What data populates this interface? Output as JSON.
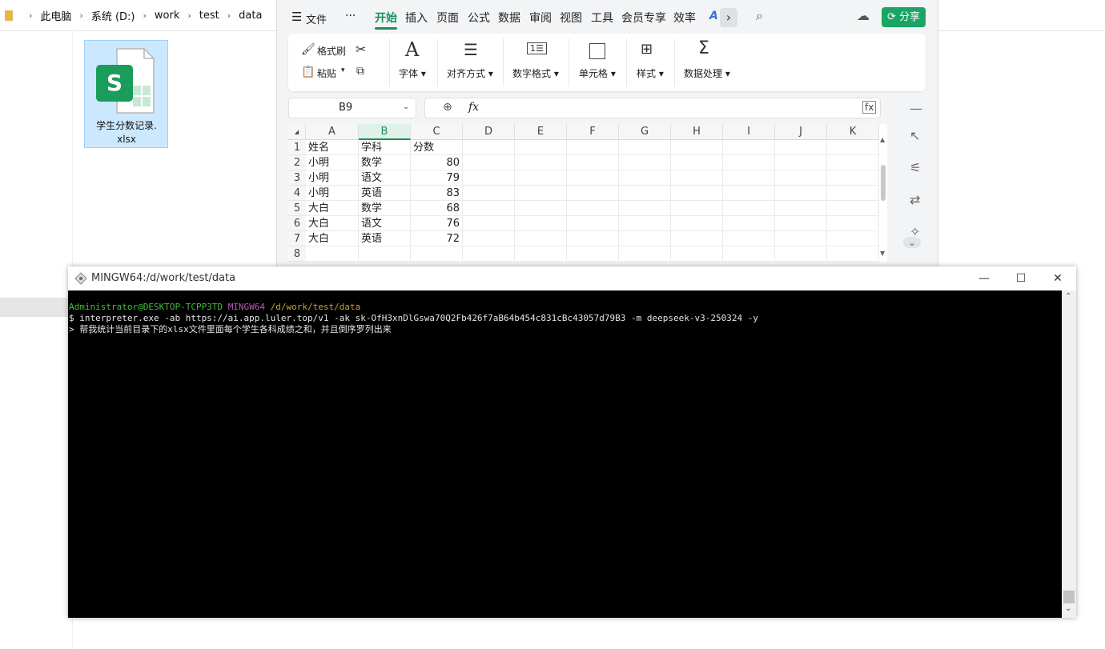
{
  "explorer": {
    "breadcrumb": [
      "此电脑",
      "系统 (D:)",
      "work",
      "test",
      "data"
    ],
    "file": {
      "name_line1": "学生分数记录.",
      "name_line2": "xlsx",
      "icon_letter": "S"
    }
  },
  "wps": {
    "menu": {
      "file": "文件",
      "more": "···",
      "tabs": [
        "开始",
        "插入",
        "页面",
        "公式",
        "数据",
        "审阅",
        "视图",
        "工具",
        "会员专享",
        "效率"
      ],
      "share": "分享"
    },
    "ribbon": {
      "format_painter": "格式刷",
      "paste": "粘贴",
      "font": "字体",
      "align": "对齐方式",
      "number_format": "数字格式",
      "cell": "单元格",
      "style": "样式",
      "data_process": "数据处理"
    },
    "formula_bar": {
      "name_box": "B9",
      "fx": "fx",
      "content": ""
    },
    "sheet": {
      "columns": [
        "A",
        "B",
        "C",
        "D",
        "E",
        "F",
        "G",
        "H",
        "I",
        "J",
        "K"
      ],
      "active_column": "B",
      "row_numbers": [
        "1",
        "2",
        "3",
        "4",
        "5",
        "6",
        "7",
        "8"
      ],
      "rows": [
        [
          "姓名",
          "学科",
          "分数"
        ],
        [
          "小明",
          "数学",
          "80"
        ],
        [
          "小明",
          "语文",
          "79"
        ],
        [
          "小明",
          "英语",
          "83"
        ],
        [
          "大白",
          "数学",
          "68"
        ],
        [
          "大白",
          "语文",
          "76"
        ],
        [
          "大白",
          "英语",
          "72"
        ],
        [
          "",
          "",
          ""
        ]
      ]
    }
  },
  "terminal": {
    "title": "MINGW64:/d/work/test/data",
    "prompt_user": "Administrator@DESKTOP-TCPP3TD",
    "prompt_env": "MINGW64",
    "prompt_path": "/d/work/test/data",
    "command": "$ interpreter.exe -ab https://ai.app.luler.top/v1 -ak sk-OfH3xnDlGswa70Q2Fb426f7aB64b454c831cBc43057d79B3 -m deepseek-v3-250324 -y",
    "input_line": "> 帮我统计当前目录下的xlsx文件里面每个学生各科成绩之和，并且倒序罗列出来",
    "colors": {
      "user": "#3fbf3f",
      "env": "#bb55bb",
      "path": "#c8a23a",
      "text": "#e6e6e6"
    }
  }
}
